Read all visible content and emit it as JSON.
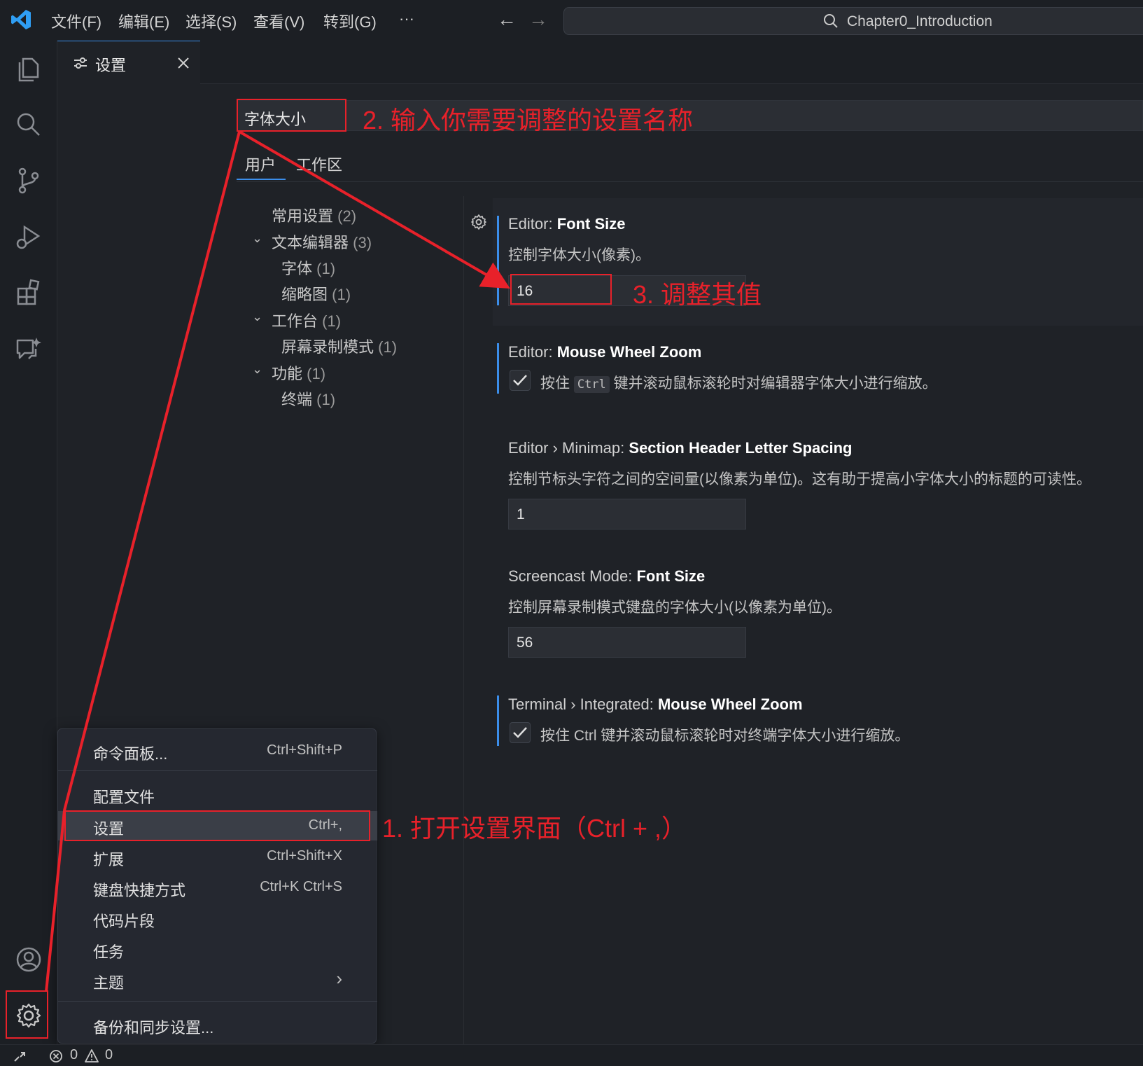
{
  "titlebar": {
    "menus": [
      "文件(F)",
      "编辑(E)",
      "选择(S)",
      "查看(V)",
      "转到(G)",
      "···"
    ],
    "search_title": "Chapter0_Introduction"
  },
  "tab": {
    "label": "设置"
  },
  "settings": {
    "search_query": "字体大小",
    "scope_tabs": [
      "用户",
      "工作区"
    ],
    "toc": [
      {
        "label": "常用设置",
        "count": "(2)"
      },
      {
        "label": "文本编辑器",
        "count": "(3)"
      },
      {
        "label": "字体",
        "count": "(1)"
      },
      {
        "label": "缩略图",
        "count": "(1)"
      },
      {
        "label": "工作台",
        "count": "(1)"
      },
      {
        "label": "屏幕录制模式",
        "count": "(1)"
      },
      {
        "label": "功能",
        "count": "(1)"
      },
      {
        "label": "终端",
        "count": "(1)"
      }
    ],
    "items": [
      {
        "prefix": "Editor: ",
        "name": "Font Size",
        "desc": "控制字体大小(像素)。",
        "value": "16"
      },
      {
        "prefix": "Editor: ",
        "name": "Mouse Wheel Zoom",
        "desc_pre": "按住 ",
        "kbd": "Ctrl",
        "desc_post": " 键并滚动鼠标滚轮时对编辑器字体大小进行缩放。"
      },
      {
        "prefix": "Editor › Minimap: ",
        "name": "Section Header Letter Spacing",
        "desc": "控制节标头字符之间的空间量(以像素为单位)。这有助于提高小字体大小的标题的可读性。",
        "value": "1"
      },
      {
        "prefix": "Screencast Mode: ",
        "name": "Font Size",
        "desc": "控制屏幕录制模式键盘的字体大小(以像素为单位)。",
        "value": "56"
      },
      {
        "prefix": "Terminal › Integrated: ",
        "name": "Mouse Wheel Zoom",
        "desc": "按住 Ctrl 键并滚动鼠标滚轮时对终端字体大小进行缩放。"
      }
    ]
  },
  "context_menu": {
    "items": [
      {
        "label": "命令面板...",
        "shortcut": "Ctrl+Shift+P"
      },
      {
        "label": "配置文件",
        "shortcut": ""
      },
      {
        "label": "设置",
        "shortcut": "Ctrl+,"
      },
      {
        "label": "扩展",
        "shortcut": "Ctrl+Shift+X"
      },
      {
        "label": "键盘快捷方式",
        "shortcut": "Ctrl+K Ctrl+S"
      },
      {
        "label": "代码片段",
        "shortcut": ""
      },
      {
        "label": "任务",
        "shortcut": ""
      },
      {
        "label": "主题",
        "shortcut": "›"
      },
      {
        "label": "备份和同步设置...",
        "shortcut": ""
      }
    ]
  },
  "statusbar": {
    "errors": "0",
    "warnings": "0"
  },
  "annotations": {
    "step1": "1. 打开设置界面（Ctrl + ,）",
    "step2": "2. 输入你需要调整的设置名称",
    "step3": "3. 调整其值"
  },
  "colors": {
    "accent": "#3b8eea",
    "annotation": "#e8212a",
    "background": "#1f2227"
  }
}
